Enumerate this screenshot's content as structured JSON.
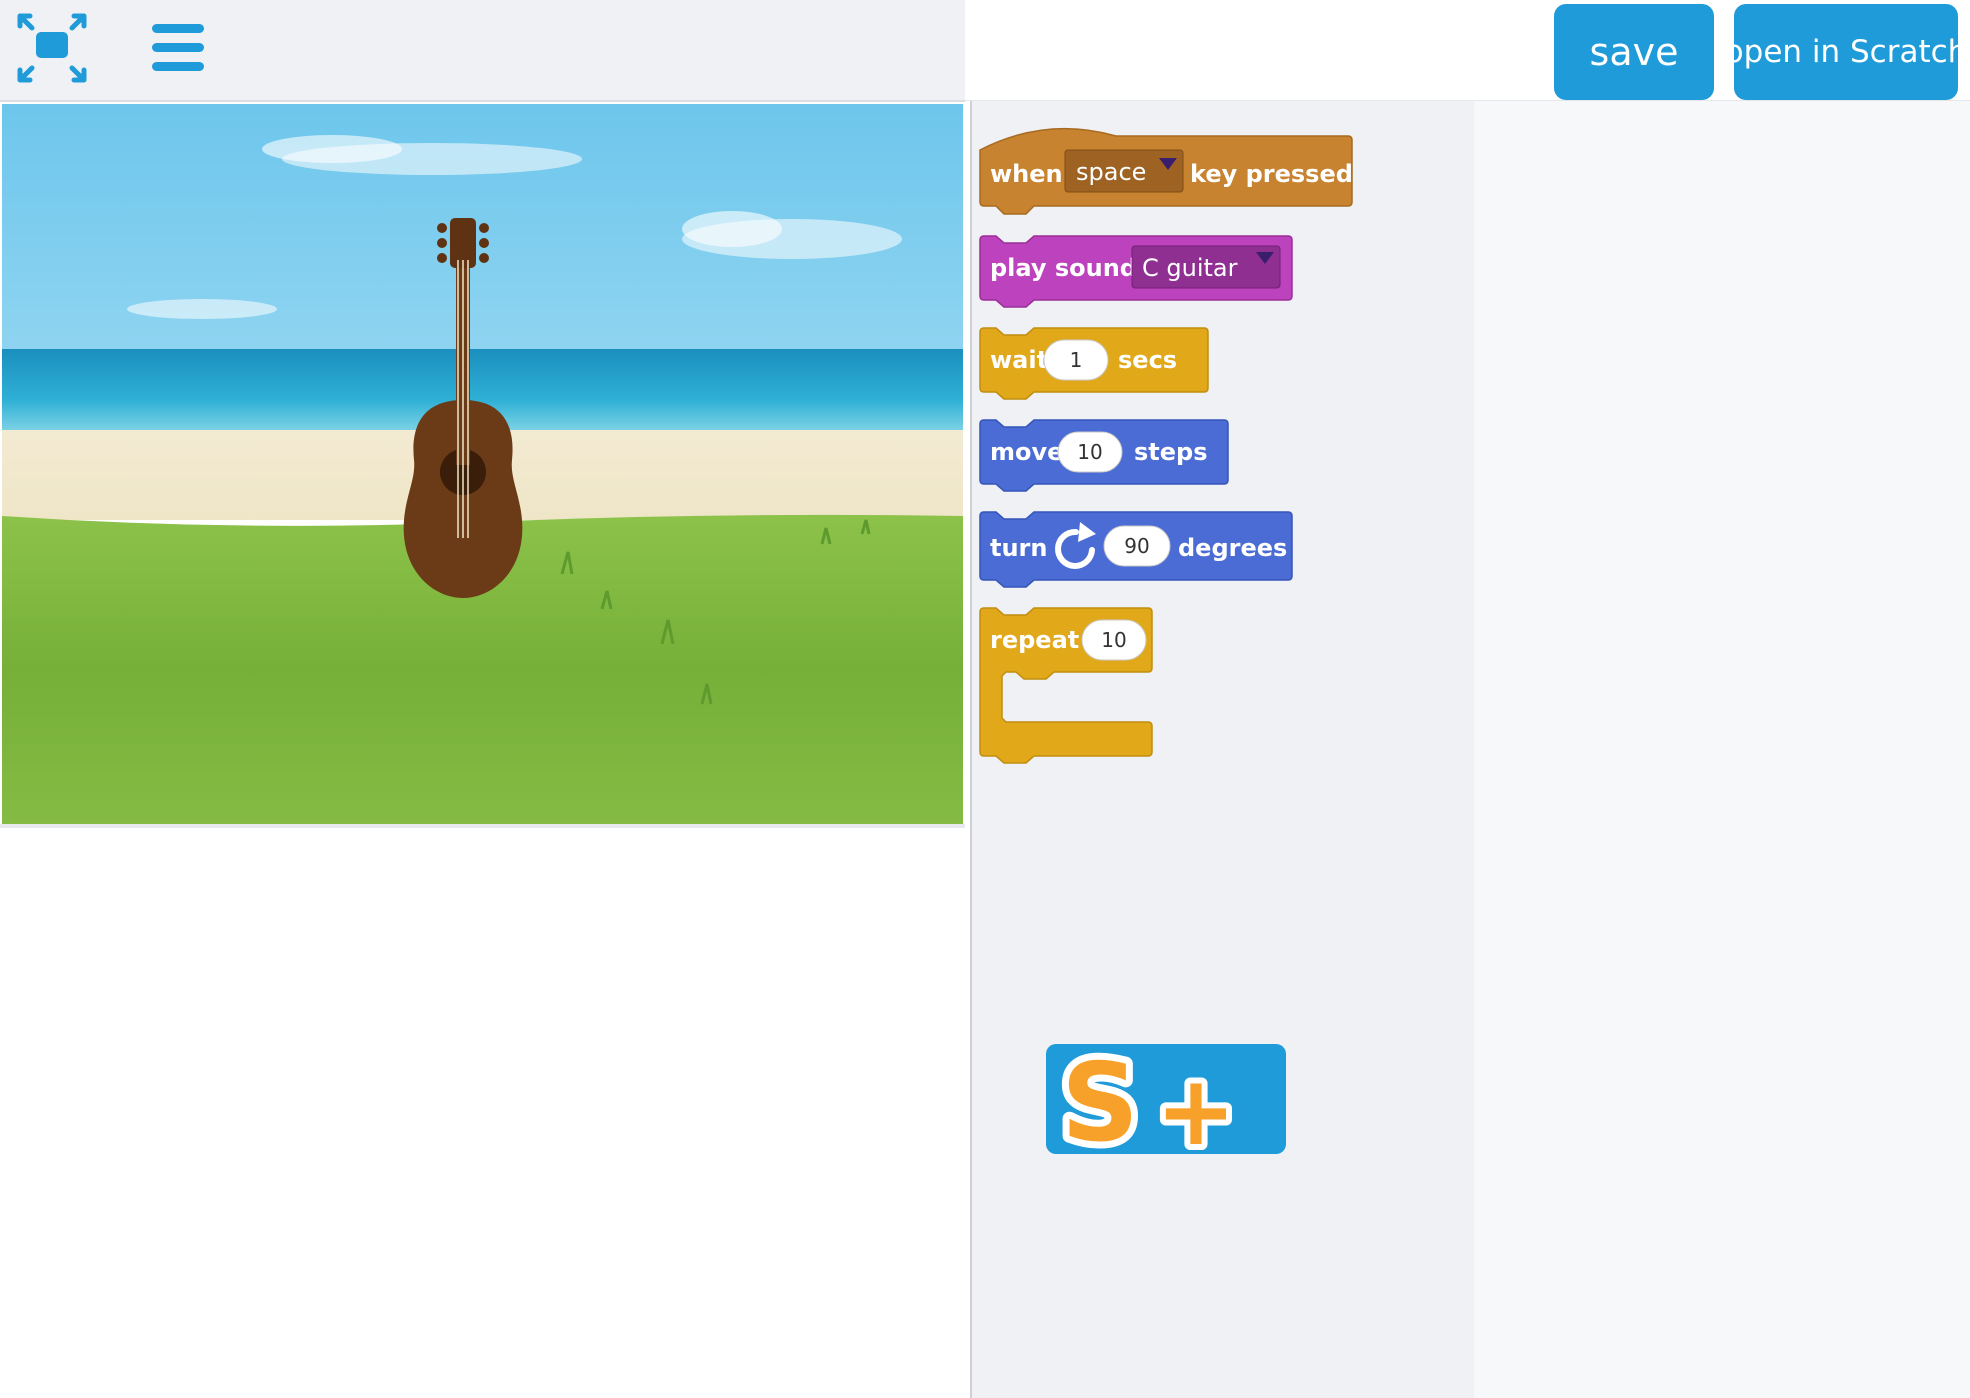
{
  "toolbar": {
    "fullscreen_icon": "fullscreen-icon",
    "menu_icon": "hamburger-menu-icon",
    "save_label": "save",
    "open_label": "open in Scratch",
    "accent_color": "#1e9bd8"
  },
  "stage": {
    "backdrop": "beach",
    "sprite": "guitar"
  },
  "blocks": {
    "when_key": {
      "prefix": "when",
      "key": "space",
      "suffix": "key pressed",
      "color": "#c88330"
    },
    "play_sound": {
      "prefix": "play sound",
      "sound": "C guitar",
      "color": "#bd42bd"
    },
    "wait": {
      "prefix": "wait",
      "value": "1",
      "suffix": "secs",
      "color": "#e1a91a"
    },
    "move": {
      "prefix": "move",
      "value": "10",
      "suffix": "steps",
      "color": "#4a6cd4"
    },
    "turn": {
      "prefix": "turn",
      "value": "90",
      "suffix": "degrees",
      "icon": "rotate-clockwise-icon",
      "color": "#4a6cd4"
    },
    "repeat": {
      "prefix": "repeat",
      "value": "10",
      "color": "#e1a91a"
    }
  },
  "splus": {
    "icon": "scratch-plus-logo",
    "letter": "S",
    "plus": "+"
  }
}
